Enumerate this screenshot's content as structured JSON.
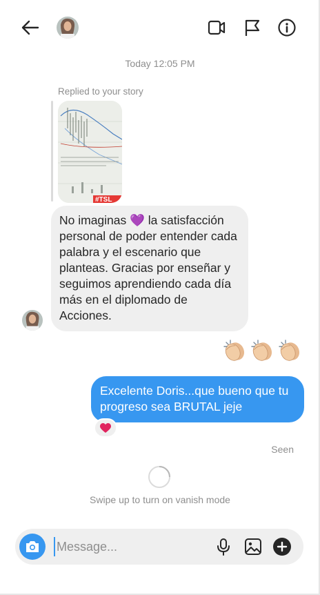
{
  "header": {
    "contact_name": "",
    "icons": [
      "back-arrow-icon",
      "video-call-icon",
      "flag-icon",
      "info-icon"
    ]
  },
  "thread": {
    "timestamp": "Today 12:05 PM",
    "reply_label": "Replied to your story",
    "story_tag": "#TSL",
    "incoming_message": "No imaginas 💜 la satisfacción personal de poder entender cada palabra y el escenario que planteas. Gracias por enseñar y seguimos aprendiendo cada día más  en el diplomado de Acciones.",
    "outgoing_emoji": "👏👏👏",
    "outgoing_message": "Excelente Doris...que bueno que tu progreso sea BRUTAL jeje",
    "reaction": "❤️",
    "seen_label": "Seen",
    "vanish_hint": "Swipe up to turn on vanish mode"
  },
  "composer": {
    "placeholder": "Message...",
    "value": "",
    "icons": [
      "camera-icon",
      "microphone-icon",
      "gallery-icon",
      "plus-icon"
    ]
  },
  "colors": {
    "accent": "#3797f0",
    "incoming_bubble": "#efefef",
    "muted_text": "#8e8e8e"
  }
}
